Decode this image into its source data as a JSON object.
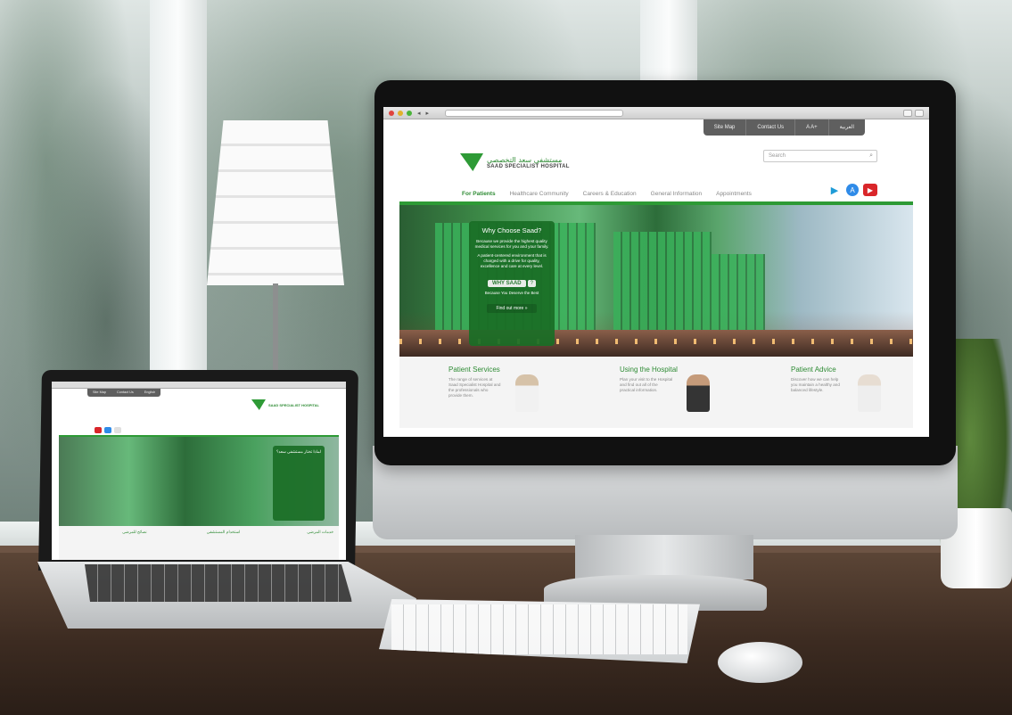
{
  "imac": {
    "utility_bar": [
      "Site Map",
      "Contact Us",
      "A A+",
      "العربية"
    ],
    "search": {
      "placeholder": "Search",
      "icon": "search-icon"
    },
    "logo": {
      "arabic": "مستشفى سعد التخصصي",
      "english": "SAAD SPECIALIST HOSPITAL"
    },
    "nav": [
      "For Patients",
      "Healthcare Community",
      "Careers & Education",
      "General Information",
      "Appointments"
    ],
    "active_nav": "For Patients",
    "app_icons": [
      "google-play-icon",
      "app-store-icon",
      "youtube-icon"
    ],
    "hero": {
      "title": "Why Choose Saad?",
      "p1": "Because we provide the highest quality medical services for you and your family.",
      "p2": "A patient-centered environment that is charged with a drive for quality, excellence and care at every level.",
      "why_label": "WHY SAAD",
      "why_mark": "?",
      "tagline": "Because You Deserve the Best",
      "cta": "Find out more »"
    },
    "services": [
      {
        "title": "Patient Services",
        "text": "The range of services at Saad Specialist Hospital and the professionals who provide them."
      },
      {
        "title": "Using the Hospital",
        "text": "Plan your visit to the Hospital and find out all of the practical information."
      },
      {
        "title": "Patient Advice",
        "text": "Discover how we can help you maintain a healthy and balanced lifestyle."
      }
    ]
  },
  "laptop": {
    "utility_bar": [
      "Site Map",
      "Contact Us",
      "English"
    ],
    "logo": {
      "english": "SAAD SPECIALIST HOSPITAL"
    },
    "hero_title": "لماذا تختار مستشفى سعد؟",
    "services": [
      {
        "title": "نصائح للمرضى"
      },
      {
        "title": "استخدام المستشفى"
      },
      {
        "title": "خدمات المرضى"
      }
    ]
  },
  "colors": {
    "brand_green": "#2e8b34",
    "accent_green": "#2d9a35",
    "bar_gray": "#5f5f5f"
  }
}
